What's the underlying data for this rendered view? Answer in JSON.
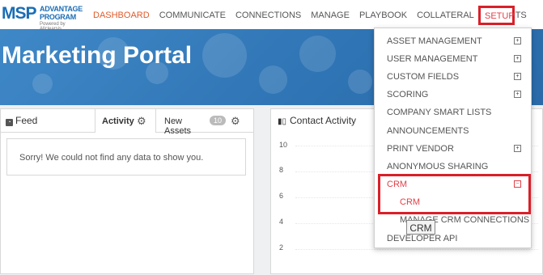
{
  "logo": {
    "main": "MSP",
    "line1": "ADVANTAGE",
    "line2": "PROGRAM",
    "powered": "Powered by Allclearsis"
  },
  "nav": {
    "items": [
      "DASHBOARD",
      "COMMUNICATE",
      "CONNECTIONS",
      "MANAGE",
      "PLAYBOOK",
      "COLLATERAL",
      "REPORTS"
    ],
    "active": "DASHBOARD",
    "setup": "SETUP"
  },
  "banner": {
    "title": "Marketing Portal"
  },
  "feed_panel": {
    "tab_feed": "Feed",
    "tab_activity": "Activity",
    "tab_assets": "New Assets",
    "assets_count": "10",
    "empty_message": "Sorry! We could not find any data to show you."
  },
  "contact_panel": {
    "title": "Contact Activity",
    "y_ticks": [
      "10",
      "8",
      "6",
      "4",
      "2"
    ]
  },
  "setup_menu": {
    "items": [
      "ASSET MANAGEMENT",
      "USER MANAGEMENT",
      "CUSTOM FIELDS",
      "SCORING",
      "COMPANY SMART LISTS",
      "ANNOUNCEMENTS",
      "PRINT VENDOR",
      "ANONYMOUS SHARING",
      "CRM"
    ],
    "crm_sub": [
      "CRM",
      "MANAGE CRM CONNECTIONS"
    ],
    "last": "DEVELOPER API",
    "expand_symbol": "+",
    "collapse_symbol": "−",
    "tooltip": "CRM"
  },
  "colors": {
    "accent": "#e05a2a",
    "brand": "#1a6db5",
    "highlight": "#d9202a"
  }
}
